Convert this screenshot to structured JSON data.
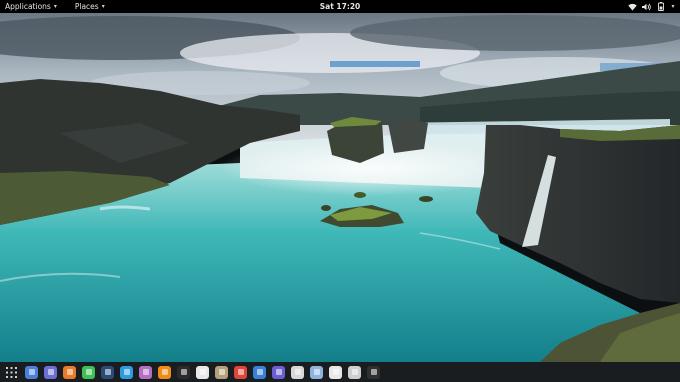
{
  "topbar": {
    "applications_label": "Applications",
    "places_label": "Places",
    "clock": "Sat 17:20",
    "tray_icons": [
      "wifi-icon",
      "volume-icon",
      "battery-icon",
      "power-icon"
    ]
  },
  "desktop": {
    "wallpaper": "waterfall landscape"
  },
  "dock": {
    "launcher_icon": "app-grid-icon",
    "apps": [
      {
        "name": "files-app-icon",
        "color": "#4c7fd8"
      },
      {
        "name": "folder-app-icon",
        "color": "#6d6fd6"
      },
      {
        "name": "firefox-app-icon",
        "color": "#e87b2a"
      },
      {
        "name": "spotify-app-icon",
        "color": "#3fbf58"
      },
      {
        "name": "steam-app-icon",
        "color": "#2a4b7a"
      },
      {
        "name": "skype-app-icon",
        "color": "#2c9be0"
      },
      {
        "name": "database-app-icon",
        "color": "#b46fc0"
      },
      {
        "name": "vlc-app-icon",
        "color": "#f08b1a"
      },
      {
        "name": "media-player-app-icon",
        "color": "#2b2b2b"
      },
      {
        "name": "music-app-icon",
        "color": "#e8e8e8"
      },
      {
        "name": "archive-app-icon",
        "color": "#b4a27a"
      },
      {
        "name": "maps-app-icon",
        "color": "#e0443a"
      },
      {
        "name": "files-manager-app-icon",
        "color": "#3a7fd8"
      },
      {
        "name": "notes-app-icon",
        "color": "#6a5fd0"
      },
      {
        "name": "calculator-app-icon",
        "color": "#d8d8d8"
      },
      {
        "name": "globe-app-icon",
        "color": "#8fb4e0"
      },
      {
        "name": "calendar-app-icon",
        "color": "#e8e8e8"
      },
      {
        "name": "text-editor-app-icon",
        "color": "#cfcfcf"
      },
      {
        "name": "terminal-app-icon",
        "color": "#2f2f2f"
      }
    ]
  }
}
